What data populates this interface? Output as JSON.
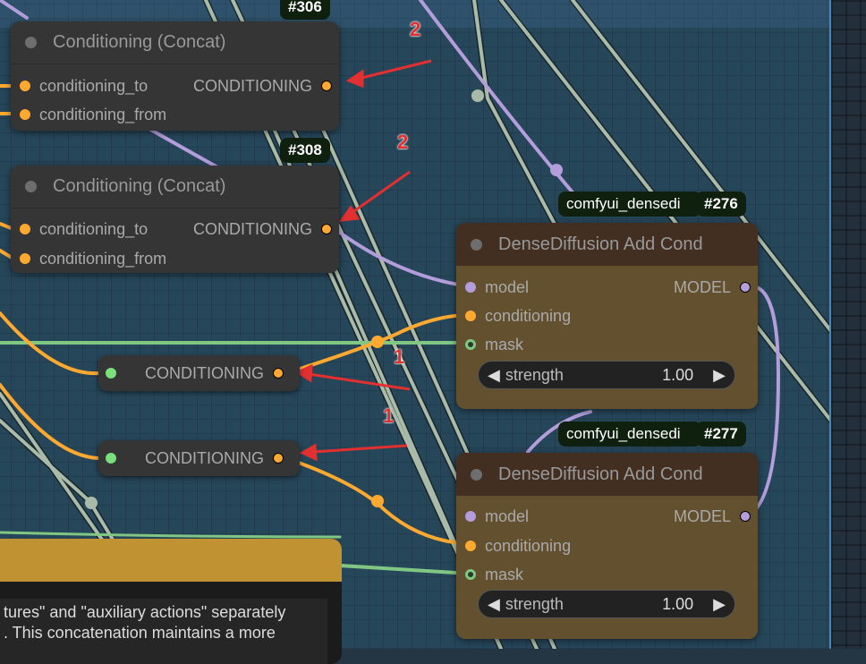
{
  "nodes": [
    {
      "id": "#306",
      "title": "Conditioning (Concat)",
      "inputs": [
        "conditioning_to",
        "conditioning_from"
      ],
      "output": "CONDITIONING"
    },
    {
      "id": "#308",
      "title": "Conditioning (Concat)",
      "inputs": [
        "conditioning_to",
        "conditioning_from"
      ],
      "output": "CONDITIONING"
    }
  ],
  "reroutes": [
    "CONDITIONING",
    "CONDITIONING"
  ],
  "dense": [
    {
      "id": "#276",
      "pack": "comfyui_densedi",
      "title": "DenseDiffusion Add Cond",
      "inputs": [
        "model",
        "conditioning",
        "mask"
      ],
      "output": "MODEL",
      "widget": {
        "label": "strength",
        "value": "1.00"
      }
    },
    {
      "id": "#277",
      "pack": "comfyui_densedi",
      "title": "DenseDiffusion Add Cond",
      "inputs": [
        "model",
        "conditioning",
        "mask"
      ],
      "output": "MODEL",
      "widget": {
        "label": "strength",
        "value": "1.00"
      }
    }
  ],
  "note": {
    "lines": [
      "tures\" and \"auxiliary actions\" separately",
      ". This concatenation maintains a more"
    ]
  },
  "annotations": [
    "2",
    "2",
    "1",
    "1"
  ],
  "colors": {
    "conditioning": "#ffa931",
    "model": "#b39ddb",
    "mask": "#81c784",
    "arrow": "#e23030"
  }
}
